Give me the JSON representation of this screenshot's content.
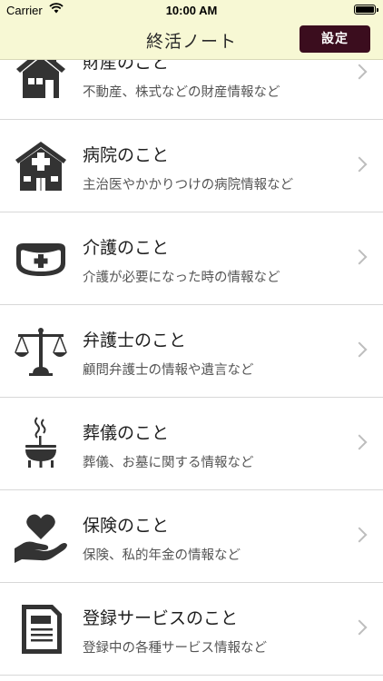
{
  "status_bar": {
    "carrier": "Carrier",
    "time": "10:00 AM"
  },
  "nav": {
    "title": "終活ノート",
    "settings_label": "設定"
  },
  "items": [
    {
      "icon": "house-icon",
      "title": "財産のこと",
      "subtitle": "不動産、株式などの財産情報など"
    },
    {
      "icon": "hospital-icon",
      "title": "病院のこと",
      "subtitle": "主治医やかかりつけの病院情報など"
    },
    {
      "icon": "nurse-cap-icon",
      "title": "介護のこと",
      "subtitle": "介護が必要になった時の情報など"
    },
    {
      "icon": "scales-icon",
      "title": "弁護士のこと",
      "subtitle": "顧問弁護士の情報や遺言など"
    },
    {
      "icon": "incense-burner-icon",
      "title": "葬儀のこと",
      "subtitle": "葬儀、お墓に関する情報など"
    },
    {
      "icon": "heart-hand-icon",
      "title": "保険のこと",
      "subtitle": "保険、私的年金の情報など"
    },
    {
      "icon": "document-icon",
      "title": "登録サービスのこと",
      "subtitle": "登録中の各種サービス情報など"
    }
  ]
}
